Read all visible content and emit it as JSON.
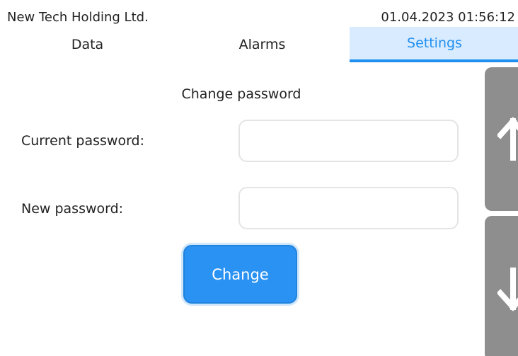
{
  "header": {
    "company": "New Tech Holding Ltd.",
    "datetime": "01.04.2023 01:56:12"
  },
  "tabs": [
    {
      "label": "Data",
      "active": false
    },
    {
      "label": "Alarms",
      "active": false
    },
    {
      "label": "Settings",
      "active": true
    }
  ],
  "form": {
    "title": "Change password",
    "current_label": "Current password:",
    "current_value": "",
    "new_label": "New password:",
    "new_value": "",
    "button_label": "Change"
  },
  "scroll": {
    "up_icon": "arrow-up-icon",
    "down_icon": "arrow-down-icon"
  },
  "colors": {
    "accent": "#1f8ff0",
    "tab_active_bg": "#d9ecff",
    "button_bg": "#2a92f2",
    "scroll_bg": "#8e8e8e"
  }
}
